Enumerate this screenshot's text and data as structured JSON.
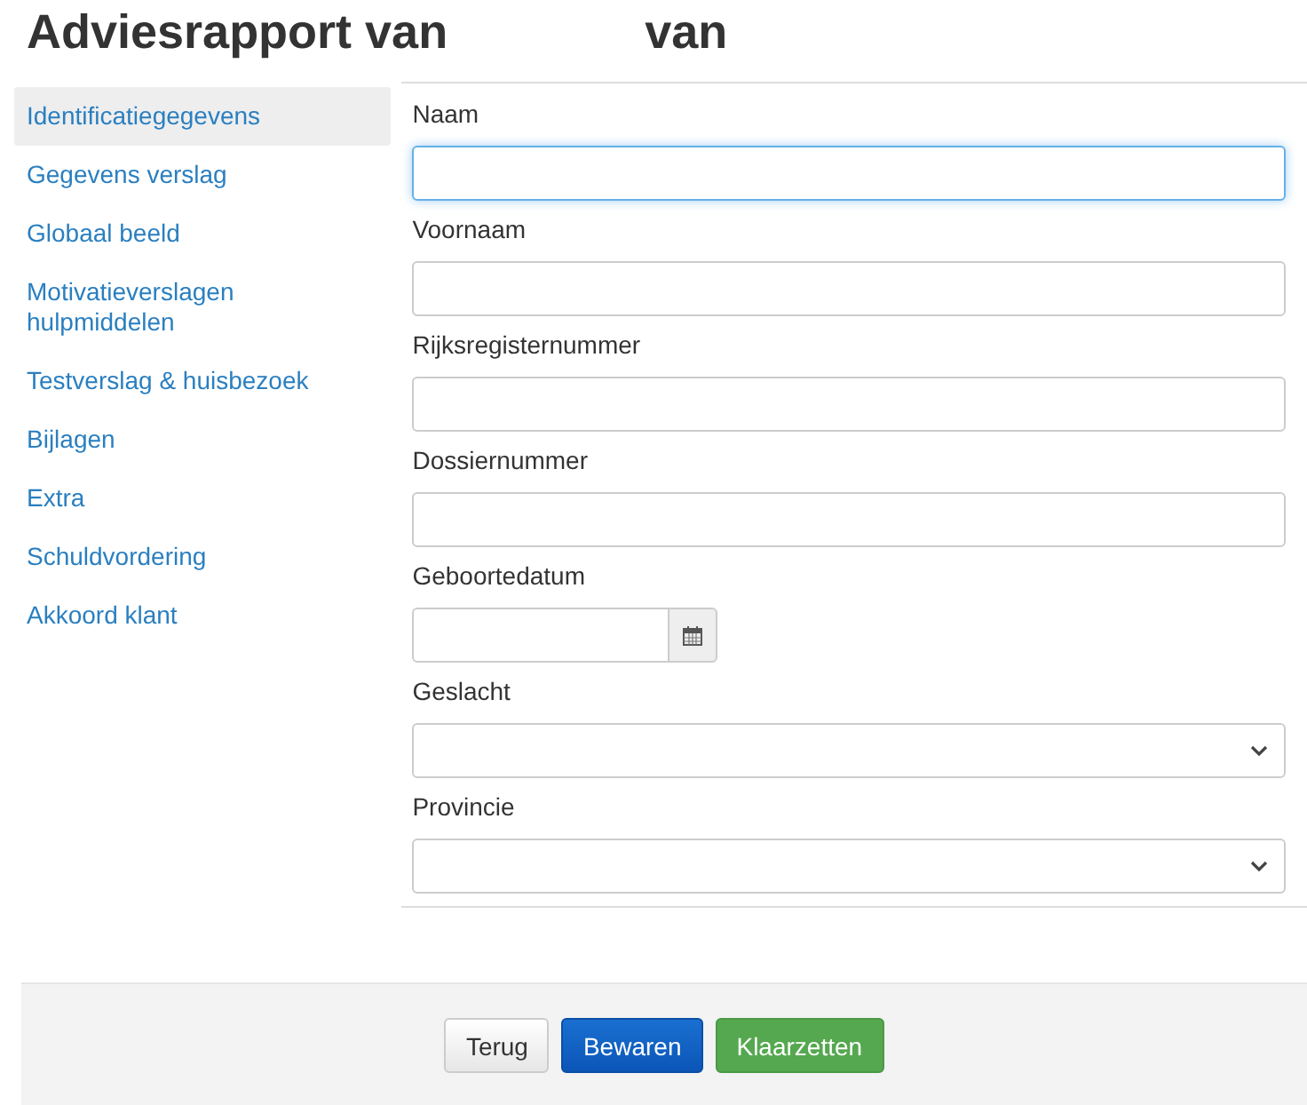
{
  "title": {
    "main": "Adviesrapport van",
    "suffix": "van"
  },
  "sidebar": {
    "items": [
      {
        "label": "Identificatiegegevens",
        "selected": true
      },
      {
        "label": "Gegevens verslag",
        "selected": false
      },
      {
        "label": "Globaal beeld",
        "selected": false
      },
      {
        "label": "Motivatieverslagen hulpmiddelen",
        "selected": false
      },
      {
        "label": "Testverslag & huisbezoek",
        "selected": false
      },
      {
        "label": "Bijlagen",
        "selected": false
      },
      {
        "label": "Extra",
        "selected": false
      },
      {
        "label": "Schuldvordering",
        "selected": false
      },
      {
        "label": "Akkoord klant",
        "selected": false
      }
    ]
  },
  "form": {
    "fields": [
      {
        "label": "Naam",
        "kind": "text",
        "focused": true
      },
      {
        "label": "Voornaam",
        "kind": "text",
        "focused": false
      },
      {
        "label": "Rijksregisternummer",
        "kind": "text",
        "focused": false
      },
      {
        "label": "Dossiernummer",
        "kind": "text",
        "focused": false
      },
      {
        "label": "Geboortedatum",
        "kind": "date",
        "focused": false
      },
      {
        "label": "Geslacht",
        "kind": "select",
        "focused": false
      },
      {
        "label": "Provincie",
        "kind": "select",
        "focused": false
      }
    ]
  },
  "buttons": [
    {
      "label": "Terug",
      "kind": "default"
    },
    {
      "label": "Bewaren",
      "kind": "primary"
    },
    {
      "label": "Klaarzetten",
      "kind": "success"
    }
  ]
}
